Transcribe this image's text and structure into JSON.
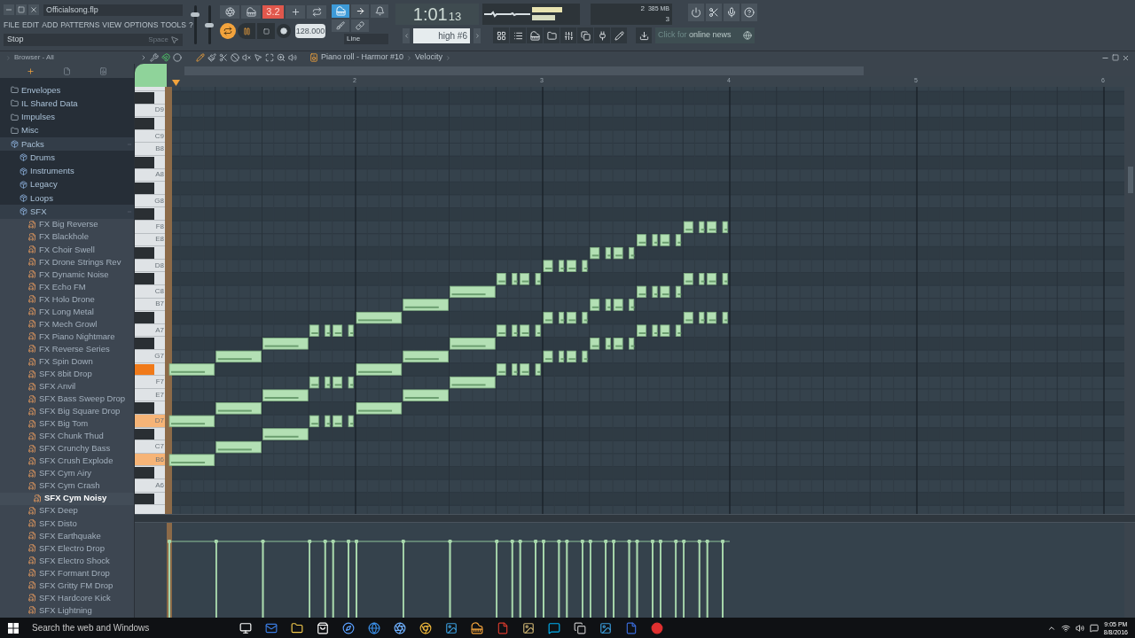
{
  "window": {
    "title": "Officialsong.flp"
  },
  "menu": [
    "FILE",
    "EDIT",
    "ADD",
    "PATTERNS",
    "VIEW",
    "OPTIONS",
    "TOOLS",
    "?"
  ],
  "hint": {
    "text": "Stop",
    "shortcut": "Space"
  },
  "transport": {
    "master_volume": {
      "level": 0.8
    },
    "master_pitch": {
      "level": 0.5
    },
    "mode_display": "3.2",
    "loop_on": true,
    "tempo": "128.000",
    "snap": "Line"
  },
  "time": {
    "main": "1:01",
    "sub": "13"
  },
  "monitor": {
    "indicator": "2",
    "memory": "385 MB",
    "polyphony": "3"
  },
  "preset": "high #6",
  "news": {
    "text": "Click for",
    "bold": "online news"
  },
  "browser": {
    "title": "Browser - All"
  },
  "piano_roll": {
    "breadcrumb": [
      "Piano roll - Harmor #10",
      "Velocity"
    ],
    "ruler": [
      "2",
      "3",
      "4",
      "5",
      "6"
    ],
    "keys": [
      {
        "kind": "white",
        "highlighted": false
      },
      {
        "kind": "black",
        "highlighted": false
      },
      {
        "kind": "white",
        "label": "D9",
        "highlighted": false
      },
      {
        "kind": "black",
        "highlighted": false
      },
      {
        "kind": "white",
        "label": "C9",
        "highlighted": false
      },
      {
        "kind": "white",
        "label": "B8",
        "highlighted": false
      },
      {
        "kind": "black",
        "highlighted": false
      },
      {
        "kind": "white",
        "label": "A8",
        "highlighted": false
      },
      {
        "kind": "black",
        "highlighted": false
      },
      {
        "kind": "white",
        "label": "G8",
        "highlighted": false
      },
      {
        "kind": "black",
        "highlighted": false
      },
      {
        "kind": "white",
        "label": "F8",
        "highlighted": false
      },
      {
        "kind": "white",
        "label": "E8",
        "highlighted": false
      },
      {
        "kind": "black",
        "highlighted": false
      },
      {
        "kind": "white",
        "label": "D8",
        "highlighted": false
      },
      {
        "kind": "black",
        "highlighted": false
      },
      {
        "kind": "white",
        "label": "C8",
        "highlighted": false
      },
      {
        "kind": "white",
        "label": "B7",
        "highlighted": false
      },
      {
        "kind": "black",
        "highlighted": false
      },
      {
        "kind": "white",
        "label": "A7",
        "highlighted": false
      },
      {
        "kind": "black",
        "highlighted": false
      },
      {
        "kind": "white",
        "label": "G7",
        "highlighted": false
      },
      {
        "kind": "black",
        "highlighted": true
      },
      {
        "kind": "white",
        "label": "F7",
        "highlighted": false
      },
      {
        "kind": "white",
        "label": "E7",
        "highlighted": false
      },
      {
        "kind": "black",
        "highlighted": false
      },
      {
        "kind": "white",
        "label": "D7",
        "highlighted": true
      },
      {
        "kind": "black",
        "highlighted": false
      },
      {
        "kind": "white",
        "label": "C7",
        "highlighted": false
      },
      {
        "kind": "white",
        "label": "B6",
        "highlighted": true
      },
      {
        "kind": "black",
        "highlighted": false
      },
      {
        "kind": "white",
        "label": "A6",
        "highlighted": false
      },
      {
        "kind": "black",
        "highlighted": false
      },
      {
        "kind": "white",
        "highlighted": false
      }
    ]
  },
  "tree": [
    {
      "label": "Envelopes",
      "kind": "folder",
      "expanded": false,
      "selected": false
    },
    {
      "label": "IL Shared Data",
      "kind": "folder",
      "expanded": false,
      "selected": false
    },
    {
      "label": "Impulses",
      "kind": "folder",
      "expanded": false,
      "selected": false
    },
    {
      "label": "Misc",
      "kind": "folder",
      "expanded": false,
      "selected": false
    },
    {
      "label": "Packs",
      "kind": "pack",
      "expanded": true,
      "selected": false,
      "children": [
        {
          "label": "Drums",
          "kind": "pack",
          "expanded": false,
          "selected": false
        },
        {
          "label": "Instruments",
          "kind": "pack",
          "expanded": false,
          "selected": false
        },
        {
          "label": "Legacy",
          "kind": "pack",
          "expanded": false,
          "selected": false
        },
        {
          "label": "Loops",
          "kind": "pack",
          "expanded": false,
          "selected": false
        },
        {
          "label": "SFX",
          "kind": "pack",
          "expanded": true,
          "selected": false,
          "children": [
            {
              "label": "FX Big Reverse",
              "kind": "sample",
              "selected": false
            },
            {
              "label": "FX Blackhole",
              "kind": "sample",
              "selected": false
            },
            {
              "label": "FX Choir Swell",
              "kind": "sample",
              "selected": false
            },
            {
              "label": "FX Drone Strings Rev",
              "kind": "sample",
              "selected": false
            },
            {
              "label": "FX Dynamic Noise",
              "kind": "sample",
              "selected": false
            },
            {
              "label": "FX Echo FM",
              "kind": "sample",
              "selected": false
            },
            {
              "label": "FX Holo Drone",
              "kind": "sample",
              "selected": false
            },
            {
              "label": "FX Long Metal",
              "kind": "sample",
              "selected": false
            },
            {
              "label": "FX Mech Growl",
              "kind": "sample",
              "selected": false
            },
            {
              "label": "FX Piano Nightmare",
              "kind": "sample",
              "selected": false
            },
            {
              "label": "FX Reverse Series",
              "kind": "sample",
              "selected": false
            },
            {
              "label": "FX Spin Down",
              "kind": "sample",
              "selected": false
            },
            {
              "label": "SFX 8bit Drop",
              "kind": "sample",
              "selected": false
            },
            {
              "label": "SFX Anvil",
              "kind": "sample",
              "selected": false
            },
            {
              "label": "SFX Bass Sweep Drop",
              "kind": "sample",
              "selected": false
            },
            {
              "label": "SFX Big Square Drop",
              "kind": "sample",
              "selected": false
            },
            {
              "label": "SFX Big Tom",
              "kind": "sample",
              "selected": false
            },
            {
              "label": "SFX Chunk Thud",
              "kind": "sample",
              "selected": false
            },
            {
              "label": "SFX Crunchy Bass",
              "kind": "sample",
              "selected": false
            },
            {
              "label": "SFX Crush Explode",
              "kind": "sample",
              "selected": false
            },
            {
              "label": "SFX Cym Airy",
              "kind": "sample",
              "selected": false
            },
            {
              "label": "SFX Cym Crash",
              "kind": "sample",
              "selected": false
            },
            {
              "label": "SFX Cym Noisy",
              "kind": "sample",
              "selected": true
            },
            {
              "label": "SFX Deep",
              "kind": "sample",
              "selected": false
            },
            {
              "label": "SFX Disto",
              "kind": "sample",
              "selected": false
            },
            {
              "label": "SFX Earthquake",
              "kind": "sample",
              "selected": false
            },
            {
              "label": "SFX Electro Drop",
              "kind": "sample",
              "selected": false
            },
            {
              "label": "SFX Electro Shock",
              "kind": "sample",
              "selected": false
            },
            {
              "label": "SFX Formant Drop",
              "kind": "sample",
              "selected": false
            },
            {
              "label": "SFX Gritty FM Drop",
              "kind": "sample",
              "selected": false
            },
            {
              "label": "SFX Hardcore Kick",
              "kind": "sample",
              "selected": false
            },
            {
              "label": "SFX Lightning",
              "kind": "sample",
              "selected": false
            }
          ]
        }
      ]
    }
  ],
  "taskbar": {
    "search_placeholder": "Search the web and Windows",
    "time": "9:05 PM",
    "date": "8/8/2016"
  }
}
